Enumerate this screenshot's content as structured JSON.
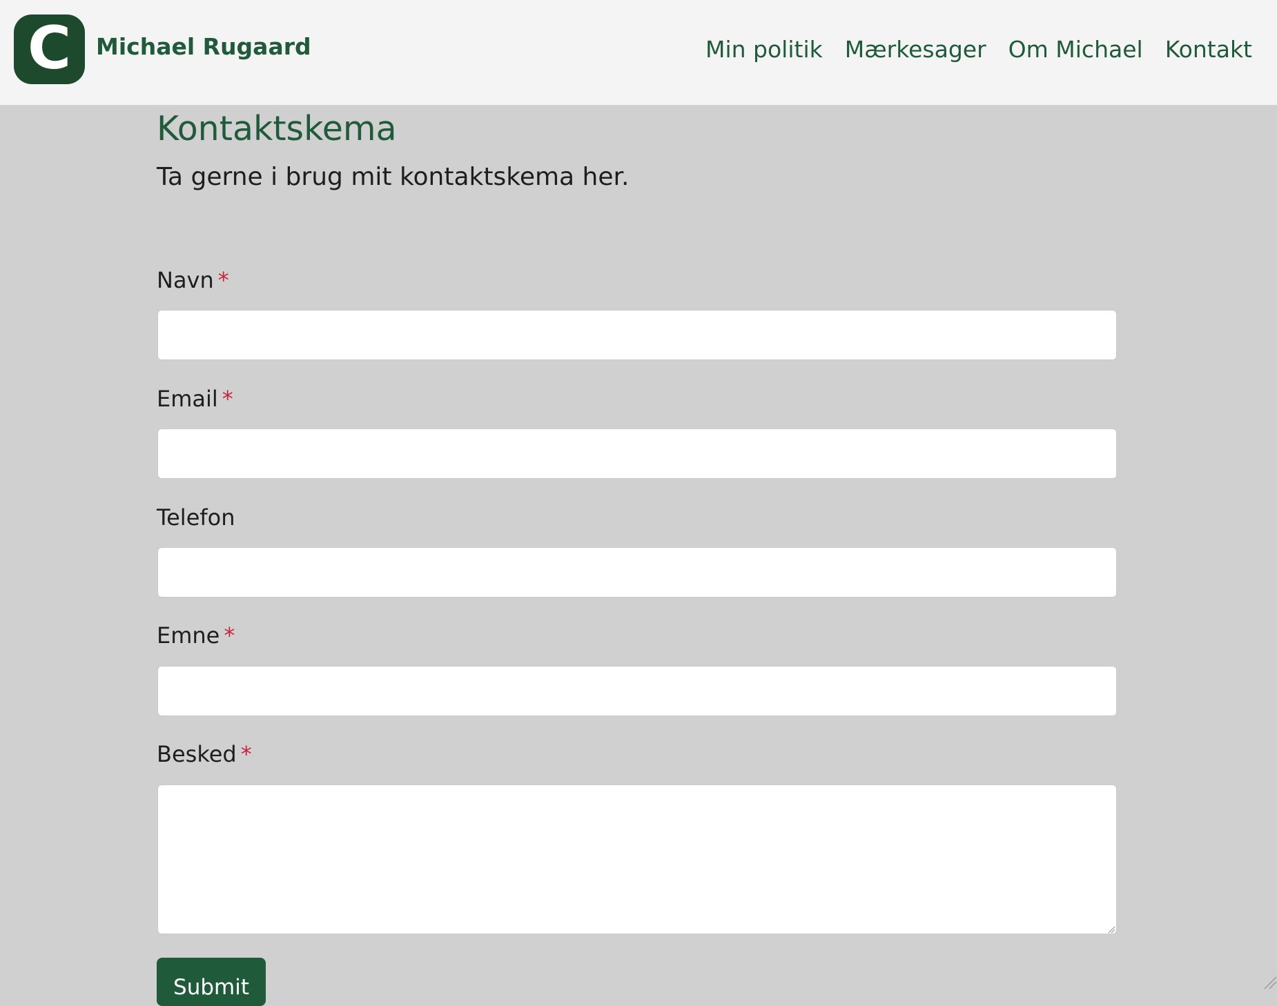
{
  "header": {
    "logo_letter": "C",
    "site_name": "Michael Rugaard",
    "nav": [
      {
        "label": "Min politik"
      },
      {
        "label": "Mærkesager"
      },
      {
        "label": "Om Michael"
      },
      {
        "label": "Kontakt"
      }
    ]
  },
  "page": {
    "title": "Kontaktskema",
    "intro": "Ta gerne i brug mit kontaktskema her."
  },
  "form": {
    "required_marker": "*",
    "fields": [
      {
        "label": "Navn",
        "value": "",
        "required": true
      },
      {
        "label": "Email",
        "value": "",
        "required": true
      },
      {
        "label": "Telefon",
        "value": "",
        "required": false
      },
      {
        "label": "Emne",
        "value": "",
        "required": true
      },
      {
        "label": "Besked",
        "value": "",
        "required": true
      }
    ],
    "submit_label": "Submit"
  },
  "colors": {
    "brand_green": "#1f5a3b",
    "logo_green": "#1d4a2d",
    "required_red": "#c5283d",
    "page_bg": "#d0d0d0",
    "header_bg": "#f4f4f4"
  }
}
